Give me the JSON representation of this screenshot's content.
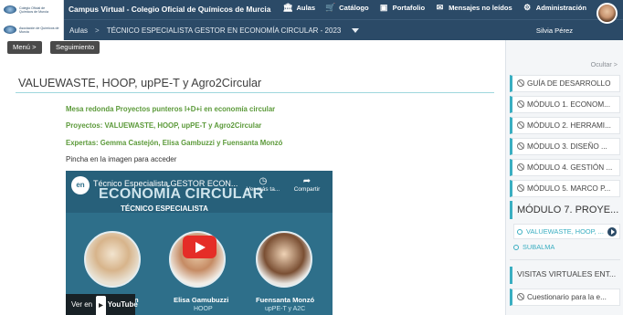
{
  "header": {
    "logo1_text": "Colegio Oficial de Químicos de Murcia",
    "logo2_text": "Asociación de Químicos de Murcia",
    "site_title": "Campus Virtual - Colegio Oficial de Químicos de Murcia",
    "nav": [
      {
        "label": "Aulas",
        "icon": "columns-icon"
      },
      {
        "label": "Catálogo",
        "icon": "cart-icon"
      },
      {
        "label": "Portafolio",
        "icon": "portfolio-icon"
      },
      {
        "label": "Mensajes no leídos",
        "icon": "mail-icon"
      },
      {
        "label": "Administración",
        "icon": "gear-icon"
      }
    ],
    "user_name": "Silvia Pérez"
  },
  "breadcrumb": {
    "root": "Aulas",
    "current": "TÉCNICO ESPECIALISTA GESTOR EN ECONOMÍA CIRCULAR - 2023"
  },
  "buttons": {
    "menu": "Menú  >",
    "tracking": "Seguimiento"
  },
  "content": {
    "title": "VALUEWASTE, HOOP, upPE-T y Agro2Circular",
    "line1": "Mesa redonda Proyectos punteros I+D+i en economía circular",
    "line2": "Proyectos: VALUEWASTE, HOOP, upPE-T y Agro2Circular",
    "line3": "Expertas: Gemma Castejón, Elisa Gambuzzi y Fuensanta Monzó",
    "instruction": "Pincha en la imagen para acceder"
  },
  "video": {
    "logo": "en",
    "title": "Técnico Especialista GESTOR ECON...",
    "big_text": "ECONOMÍA CIRCULAR",
    "subtitle": "TÉCNICO ESPECIALISTA",
    "watch_later": "Ver más ta...",
    "share": "Compartir",
    "names": [
      "n",
      "Elisa Gamubuzzi",
      "Fuensanta Monzó"
    ],
    "orgs": [
      "HOOP",
      "upPE-T y A2C"
    ],
    "watch_on": "Ver en",
    "youtube": "YouTube"
  },
  "index": {
    "hide_label": "Ocultar >",
    "modules": [
      "GUÍA DE DESARROLLO",
      "MÓDULO 1. ECONOM...",
      "MÓDULO 2. HERRAMI...",
      "MÓDULO 3. DISEÑO ...",
      "MÓDULO 4. GESTIÓN ...",
      "MÓDULO 5. MARCO P..."
    ],
    "current_module": "MÓDULO 7. PROYE...",
    "lessons": [
      "VALUEWASTE, HOOP, ...",
      "SUBALMA"
    ],
    "visits": "VISITAS VIRTUALES ENT...",
    "questionnaire": "Cuestionario para la e..."
  },
  "colors": {
    "header_bg": "#2b4a67",
    "accent": "#3aaec1",
    "green_text": "#5c9a3a"
  }
}
